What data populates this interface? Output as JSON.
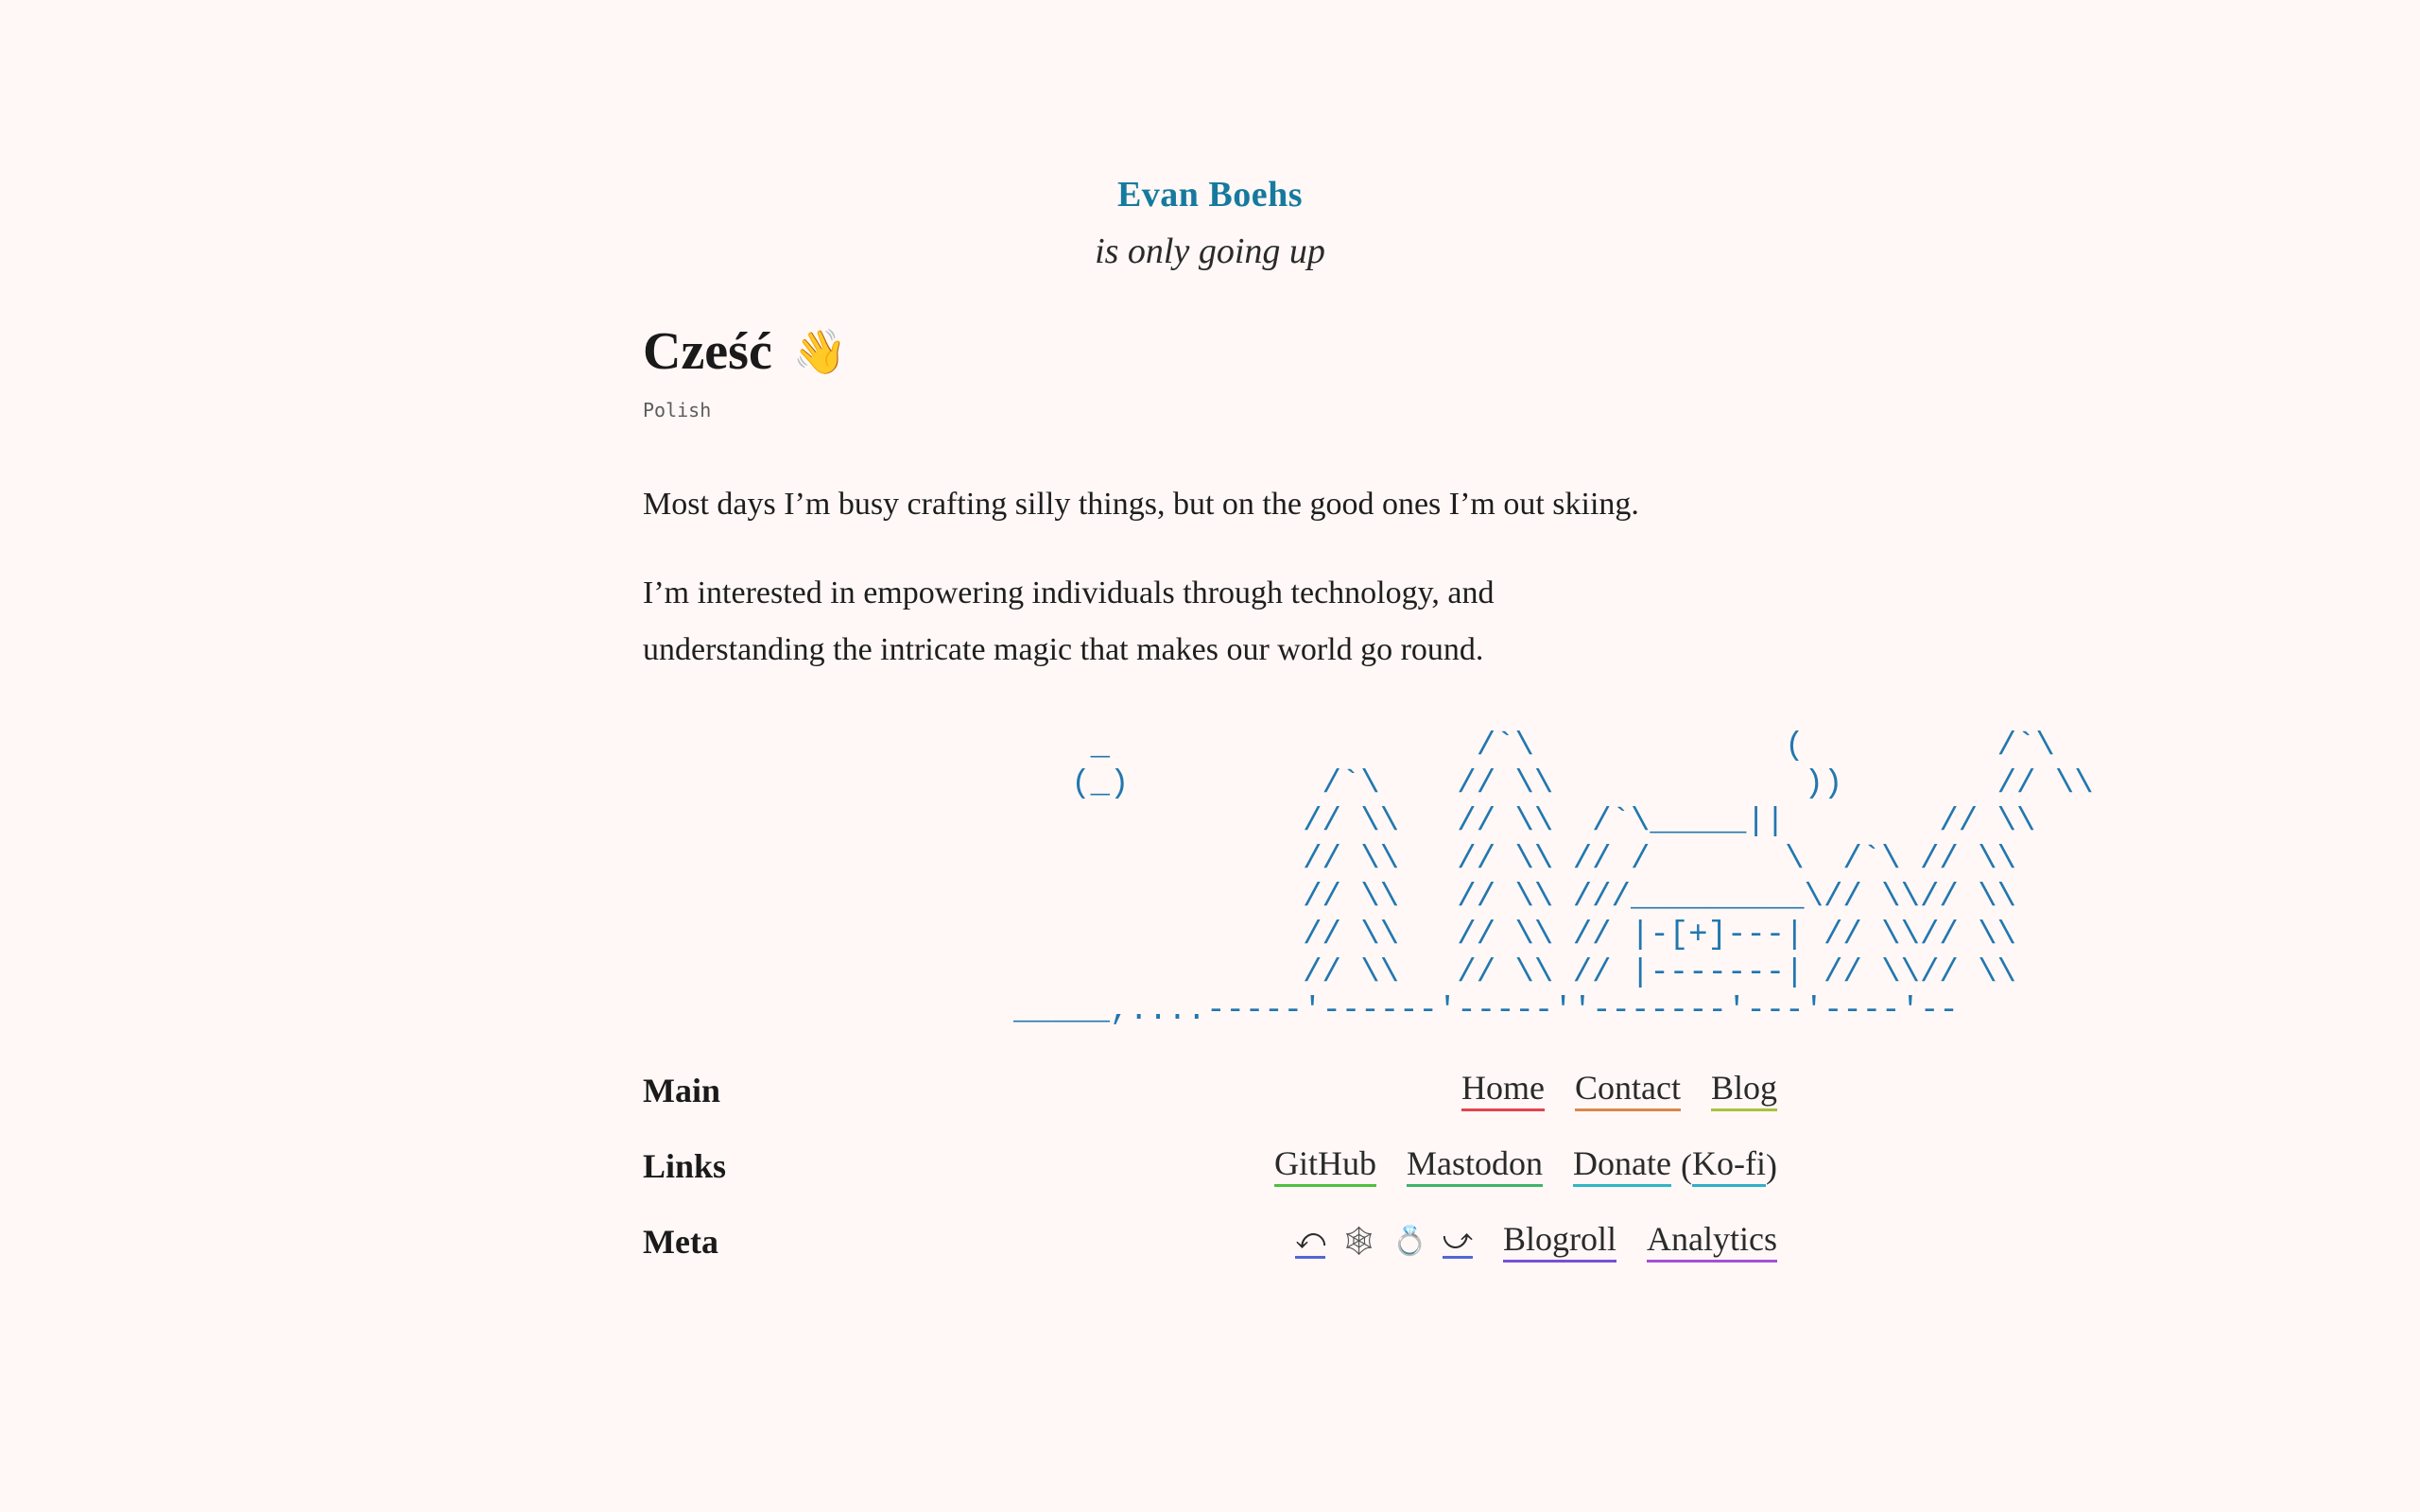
{
  "site": {
    "title": "Evan Boehs",
    "tagline": "is only going up"
  },
  "greeting": {
    "word": "Cześć",
    "emoji": "👋",
    "language": "Polish"
  },
  "bio": {
    "paragraph1": "Most days I’m busy crafting silly things, but on the good ones I’m out skiing.",
    "paragraph2_line1": "I’m interested in empowering individuals through technology, and",
    "paragraph2_line2": "understanding the intricate magic that makes our world go round."
  },
  "ascii_art": "              _                   /`\\             (          /`\\\n             (_)          /`\\    // \\\\             ))        // \\\\\n                         // \\\\   // \\\\  /`\\_____||        // \\\\\n                         // \\\\   // \\\\ // /       \\  /`\\ // \\\\\n                         // \\\\   // \\\\ ///_________\\// \\\\// \\\\\n                         // \\\\   // \\\\ // |-[+]---| // \\\\// \\\\\n                         // \\\\   // \\\\ // |-------| // \\\\// \\\\\n          _____,....-----'------'-----''-------'---'----'--",
  "nav": {
    "main": {
      "label": "Main",
      "items": [
        {
          "label": "Home",
          "color": "#e0444f"
        },
        {
          "label": "Contact",
          "color": "#d8884a"
        },
        {
          "label": "Blog",
          "color": "#a9c23c"
        }
      ]
    },
    "links": {
      "label": "Links",
      "items": [
        {
          "label": "GitHub",
          "color": "#4fbf3f"
        },
        {
          "label": "Mastodon",
          "color": "#3fb36a"
        },
        {
          "label": "Donate",
          "color": "#2fb7c4"
        },
        {
          "label": "Ko-fi",
          "color": "#2fb0c8"
        }
      ],
      "paren_open": "(",
      "paren_close": ")"
    },
    "meta": {
      "label": "Meta",
      "ring_prev": "⤺",
      "ring_web": "🕸",
      "ring_ring": "💍",
      "ring_next": "⤻",
      "items": [
        {
          "label": "Blogroll",
          "color": "#7a4fd6"
        },
        {
          "label": "Analytics",
          "color": "#a64fd6"
        }
      ]
    }
  },
  "colors": {
    "background": "#fff8f6",
    "accent": "#157a9e",
    "ascii": "#2277b0"
  }
}
